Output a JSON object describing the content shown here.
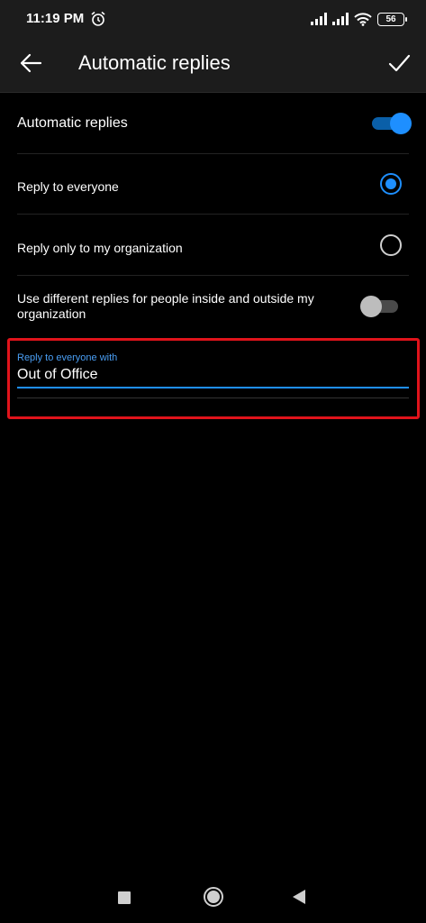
{
  "status_bar": {
    "time": "11:19 PM",
    "battery": "56",
    "icons": [
      "alarm-icon",
      "signal-icon",
      "signal-icon",
      "wifi-icon",
      "battery-icon"
    ]
  },
  "app_bar": {
    "title": "Automatic replies",
    "back_icon": "arrow-left-icon",
    "confirm_icon": "check-icon"
  },
  "settings": {
    "automatic_replies": {
      "label": "Automatic replies",
      "enabled": true
    },
    "reply_everyone": {
      "label": "Reply to everyone",
      "selected": true
    },
    "reply_org": {
      "label": "Reply only to my organization",
      "selected": false
    },
    "different_replies": {
      "label": "Use different replies for people inside and outside my organization",
      "enabled": false
    }
  },
  "reply_field": {
    "label": "Reply to everyone with",
    "value": "Out of Office"
  },
  "colors": {
    "accent": "#1e8fff",
    "highlight": "#e0131b",
    "background": "#000000",
    "app_bar": "#1c1c1c"
  },
  "nav_bar": {
    "icons": [
      "recents-icon",
      "home-icon",
      "back-triangle-icon"
    ]
  }
}
